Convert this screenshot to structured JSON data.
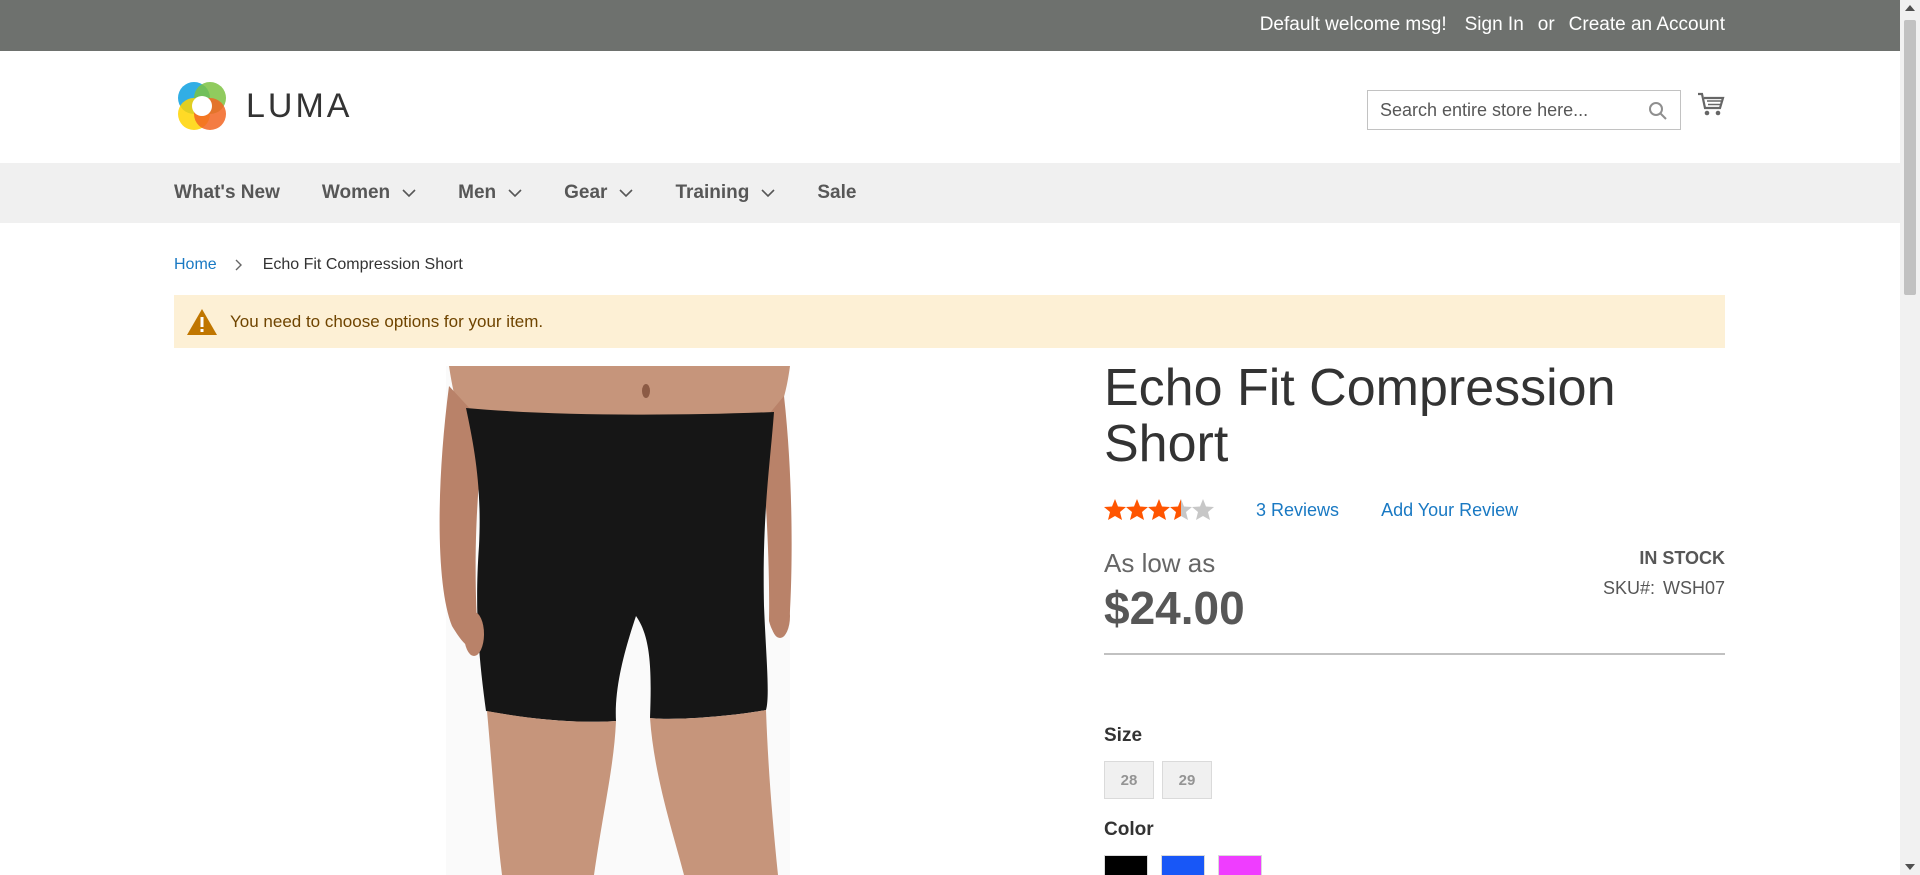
{
  "topbar": {
    "welcome": "Default welcome msg!",
    "sign_in": "Sign In",
    "or": "or",
    "create_account": "Create an Account"
  },
  "header": {
    "logo_text": "LUMA",
    "search_placeholder": "Search entire store here...",
    "cart_icon": "cart-icon",
    "search_icon": "search-icon"
  },
  "nav": {
    "items": [
      {
        "label": "What's New",
        "dropdown": false
      },
      {
        "label": "Women",
        "dropdown": true
      },
      {
        "label": "Men",
        "dropdown": true
      },
      {
        "label": "Gear",
        "dropdown": true
      },
      {
        "label": "Training",
        "dropdown": true
      },
      {
        "label": "Sale",
        "dropdown": false
      }
    ]
  },
  "breadcrumb": {
    "home": "Home",
    "current": "Echo Fit Compression Short"
  },
  "notice": {
    "message": "You need to choose options for your item.",
    "icon": "warning-icon"
  },
  "product": {
    "name": "Echo Fit Compression Short",
    "rating_stars": 3.5,
    "rating_max": 5,
    "reviews_count": "3",
    "reviews_label": "Reviews",
    "add_review": "Add Your Review",
    "price_label": "As low as",
    "price": "$24.00",
    "stock": "IN STOCK",
    "sku_label": "SKU#:",
    "sku": "WSH07",
    "size_label": "Size",
    "sizes": [
      "28",
      "29"
    ],
    "color_label": "Color",
    "colors": [
      "#000000",
      "#1857f7",
      "#ef3dff"
    ]
  },
  "colors": {
    "topbar_bg": "#6e716e",
    "link": "#1979c3",
    "star": "#ff5501",
    "notice_bg": "#fdf0d5"
  }
}
